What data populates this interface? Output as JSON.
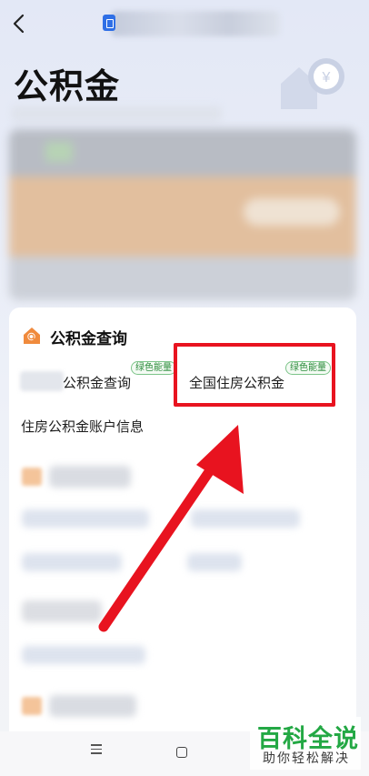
{
  "page": {
    "title": "公积金"
  },
  "colors": {
    "accent": "#e8131f",
    "tag_green": "#2a8b3a",
    "brand_orange": "#f08a3c",
    "app_blue": "#2f6fe6"
  },
  "section": {
    "title": "公积金查询",
    "icon": "house-search-icon",
    "items": [
      {
        "label": "公积金查询",
        "tag": "绿色能量"
      },
      {
        "label": "全国住房公积金",
        "tag": "绿色能量"
      },
      {
        "label": "住房公积金账户信息"
      }
    ]
  },
  "nav": {
    "menu_icon": "menu-icon",
    "home_icon": "home-square-icon"
  },
  "watermark": {
    "brand": "百科全说",
    "slogan": "助你轻松解决"
  }
}
